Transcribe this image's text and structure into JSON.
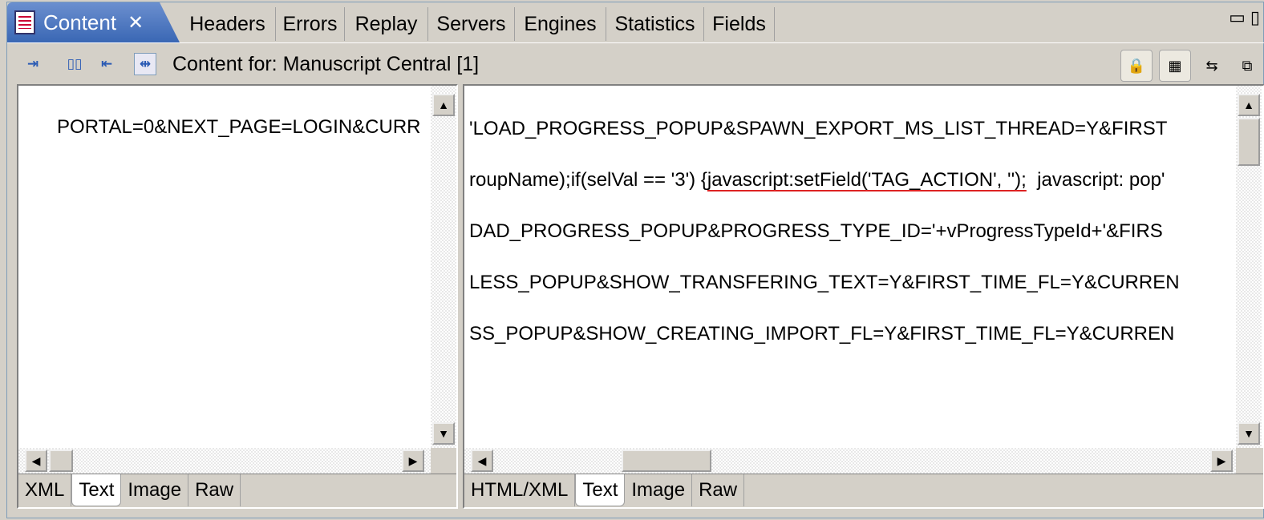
{
  "tabs": {
    "active_label": "Content",
    "items": [
      "Headers",
      "Errors",
      "Replay",
      "Servers",
      "Engines",
      "Statistics",
      "Fields"
    ]
  },
  "toolbar": {
    "content_title": "Content for: Manuscript Central [1]"
  },
  "left_panel": {
    "text": "PORTAL=0&NEXT_PAGE=LOGIN&CURR",
    "bottom_tabs": [
      "XML",
      "Text",
      "Image",
      "Raw"
    ],
    "active_tab": "Text"
  },
  "right_panel": {
    "lines": [
      "'LOAD_PROGRESS_POPUP&SPAWN_EXPORT_MS_LIST_THREAD=Y&FIRST",
      "roupName);if(selVal == '3') {",
      "javascript:setField('TAG_ACTION', '');",
      "  javascript: pop'",
      "DAD_PROGRESS_POPUP&PROGRESS_TYPE_ID='+vProgressTypeId+'&FIRS",
      "LESS_POPUP&SHOW_TRANSFERING_TEXT=Y&FIRST_TIME_FL=Y&CURREN",
      "SS_POPUP&SHOW_CREATING_IMPORT_FL=Y&FIRST_TIME_FL=Y&CURREN"
    ],
    "bottom_tabs": [
      "HTML/XML",
      "Text",
      "Image",
      "Raw"
    ],
    "active_tab": "Text"
  },
  "colors": {
    "active_tab_bg": "#3a67b4",
    "squiggle": "#dd2222"
  }
}
